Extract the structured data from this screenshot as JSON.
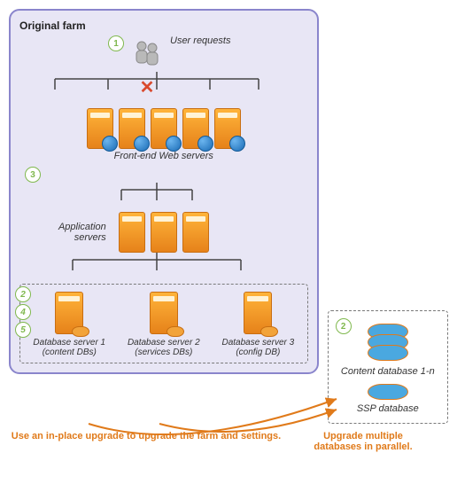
{
  "farm": {
    "title": "Original farm",
    "user_requests_label": "User requests",
    "web_servers_label": "Front-end Web servers",
    "web_server_count": 5,
    "app_servers_label": "Application servers",
    "app_server_count": 3,
    "db_servers": [
      {
        "label": "Database server 1 (content DBs)"
      },
      {
        "label": "Database server 2 (services DBs)"
      },
      {
        "label": "Database server 3 (config DB)"
      }
    ],
    "db1_steps": [
      "2",
      "4",
      "5"
    ]
  },
  "steps": {
    "s1": "1",
    "s2": "2",
    "s3": "3"
  },
  "right": {
    "content_db_label": "Content database 1-n",
    "ssp_db_label": "SSP database"
  },
  "captions": {
    "left": "Use an in-place upgrade to upgrade the farm and settings.",
    "right": "Upgrade multiple databases in parallel."
  }
}
